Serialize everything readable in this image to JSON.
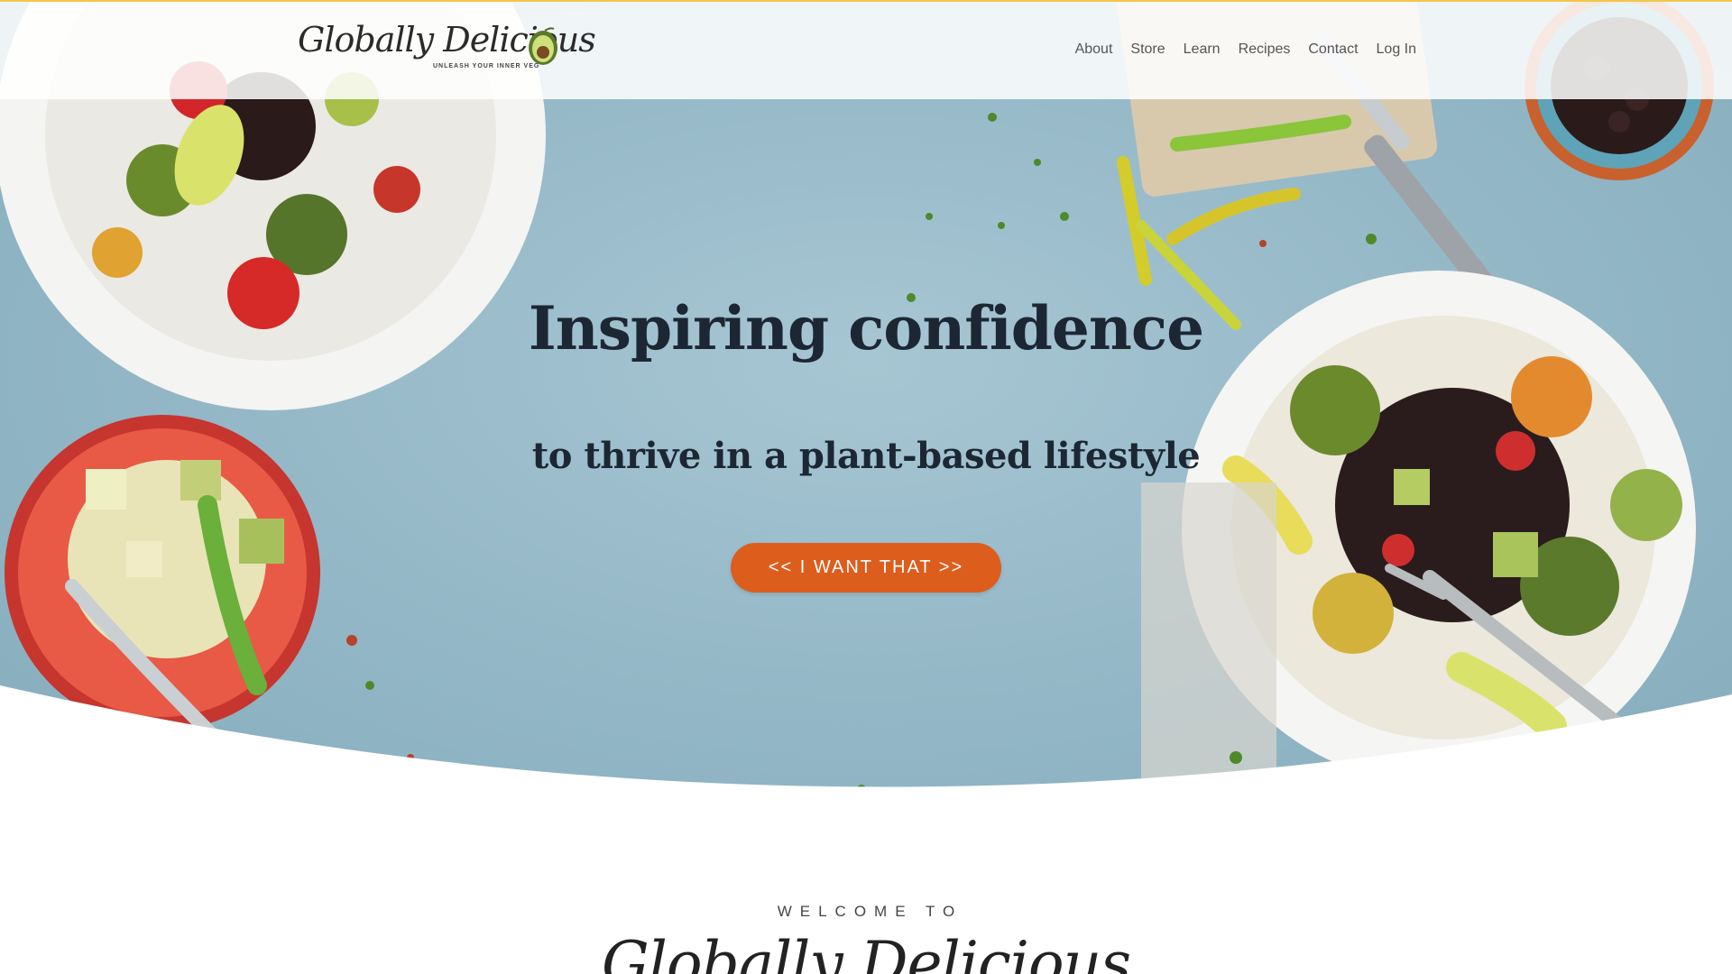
{
  "brand": {
    "name": "Globally Delicious",
    "tagline": "UNLEASH YOUR INNER VEG"
  },
  "nav": {
    "items": [
      "About",
      "Store",
      "Learn",
      "Recipes",
      "Contact",
      "Log In"
    ]
  },
  "hero": {
    "title": "Inspiring confidence",
    "subtitle": "to thrive in a plant-based lifestyle",
    "cta_label": "<< I WANT THAT >>"
  },
  "welcome": {
    "eyebrow": "WELCOME TO",
    "brand": "Globally Delicious"
  },
  "colors": {
    "accent": "#dd5d1d",
    "hero_bg": "#93b7c6",
    "header_top_border": "#f3c64a",
    "heading_text": "#1d2733"
  },
  "icons": [
    "avocado-icon"
  ]
}
